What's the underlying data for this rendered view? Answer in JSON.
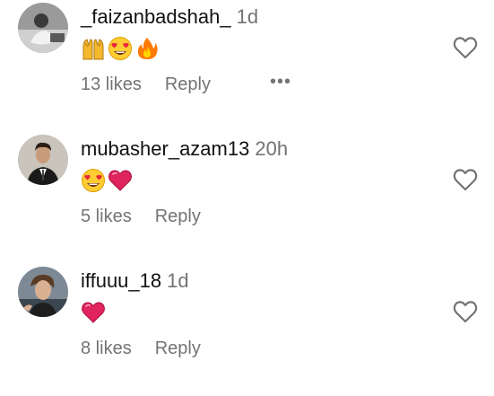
{
  "comments": [
    {
      "username": "_faizanbadshah_",
      "time": "1d",
      "likes": "13 likes",
      "reply": "Reply",
      "emojis": [
        "raising-hands-emoji",
        "heart-eyes-emoji",
        "fire-emoji"
      ],
      "has_more": true
    },
    {
      "username": "mubasher_azam13",
      "time": "20h",
      "likes": "5 likes",
      "reply": "Reply",
      "emojis": [
        "heart-eyes-emoji",
        "red-heart-emoji"
      ],
      "has_more": false
    },
    {
      "username": "iffuuu_18",
      "time": "1d",
      "likes": "8 likes",
      "reply": "Reply",
      "emojis": [
        "red-heart-emoji"
      ],
      "has_more": false
    }
  ],
  "icons": {
    "like": "heart-outline-icon",
    "more": "more-dots-icon"
  },
  "colors": {
    "username": "#111111",
    "meta": "#737373",
    "heart": "#e0245e"
  }
}
